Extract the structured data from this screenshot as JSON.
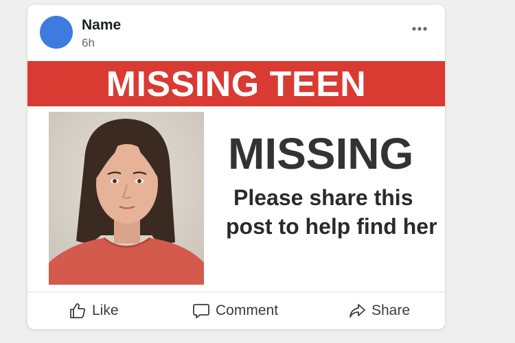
{
  "post": {
    "author_name": "Name",
    "time": "6h",
    "banner_text": "MISSING TEEN",
    "headline": "MISSING",
    "subtext_line1": "Please share this",
    "subtext_line2": "post to help find her"
  },
  "actions": {
    "like": "Like",
    "comment": "Comment",
    "share": "Share"
  },
  "icons": {
    "menu": "more-options-icon",
    "like": "thumbs-up-icon",
    "comment": "speech-bubble-icon",
    "share": "share-arrow-icon"
  },
  "colors": {
    "banner": "#d93a32",
    "avatar": "#3e7be0",
    "page_background": "#efefef"
  }
}
